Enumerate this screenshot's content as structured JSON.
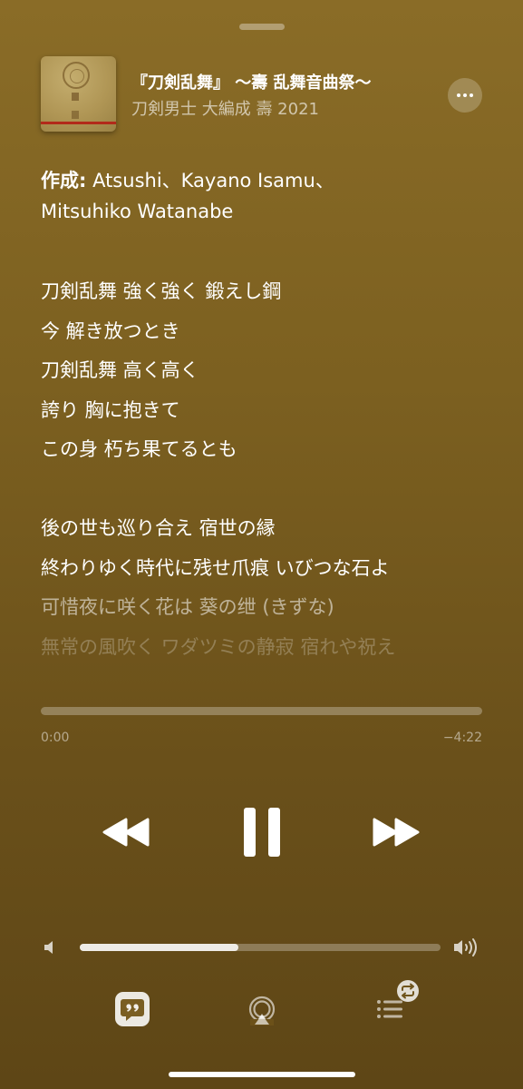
{
  "now_playing": {
    "title": "『刀剣乱舞』 〜壽 乱舞音曲祭〜",
    "artist": "刀剣男士 大編成 壽 2021"
  },
  "credits": {
    "label": "作成:",
    "line1": " Atsushi、Kayano Isamu、",
    "line2": "Mitsuhiko Watanabe"
  },
  "lyrics": {
    "stanza1": [
      "刀剣乱舞 強く強く 鍛えし鋼",
      "今 解き放つとき",
      "刀剣乱舞 高く高く",
      "誇り 胸に抱きて",
      "この身 朽ち果てるとも"
    ],
    "stanza2": [
      "後の世も巡り合え 宿世の縁",
      "終わりゆく時代に残せ爪痕 いびつな石よ",
      "可惜夜に咲く花は 葵の绁 (きずな)",
      "無常の風吹く ワダツミの静寂 宿れや祝え"
    ]
  },
  "playback": {
    "elapsed": "0:00",
    "remaining": "−4:22",
    "progress_fraction": 0.0,
    "volume_fraction": 0.44
  },
  "icons": {
    "more": "ellipsis-icon",
    "rewind": "rewind-icon",
    "pause": "pause-icon",
    "forward": "fast-forward-icon",
    "volume_low": "speaker-low-icon",
    "volume_high": "speaker-high-icon",
    "lyrics": "lyrics-quote-icon",
    "airplay": "airplay-icon",
    "queue": "queue-list-icon",
    "repeat": "repeat-icon"
  }
}
